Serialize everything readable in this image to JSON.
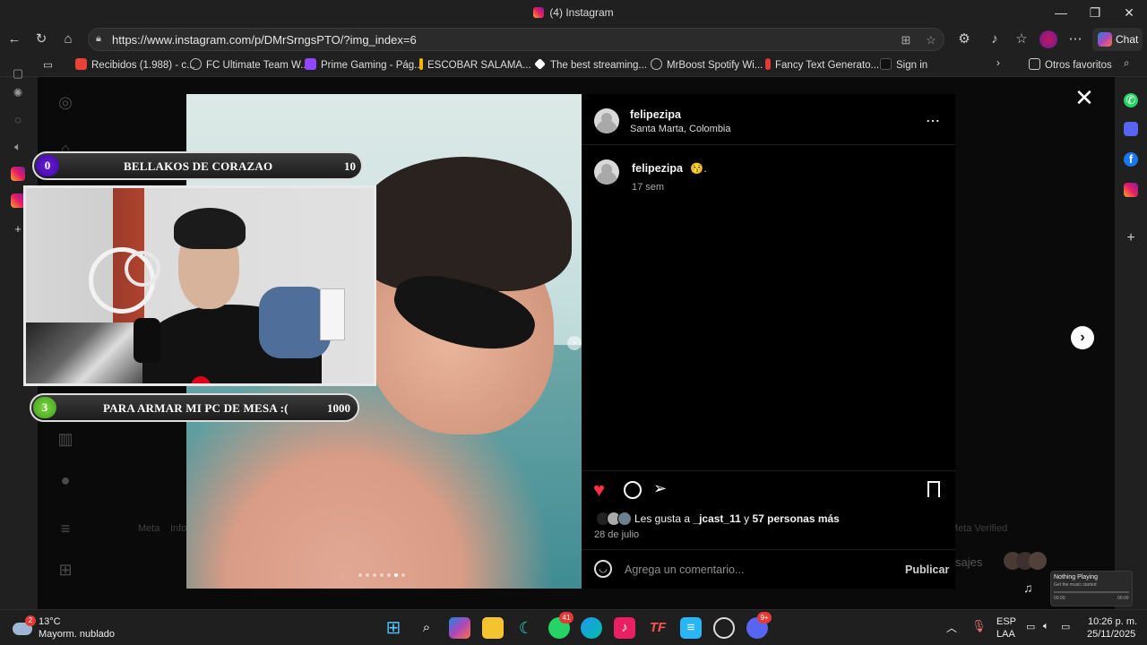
{
  "window": {
    "title": "(4) Instagram",
    "minimize": "—",
    "maximize": "❐",
    "close": "✕"
  },
  "nav": {
    "url": "https://www.instagram.com/p/DMrSrngsPTO/?img_index=6",
    "chat_label": "Chat"
  },
  "bookmarks": [
    {
      "label": "Recibidos (1.988) - c...",
      "color": "#ea4335"
    },
    {
      "label": "FC Ultimate Team W...",
      "color": "#888888"
    },
    {
      "label": "Prime Gaming - Pág...",
      "color": "#9146ff"
    },
    {
      "label": "ESCOBAR SALAMA...",
      "color": "#f4b400"
    },
    {
      "label": "The best streaming...",
      "color": "#ffffff"
    },
    {
      "label": "MrBoost Spotify Wi...",
      "color": "#888888"
    },
    {
      "label": "Fancy Text Generato...",
      "color": "#e53935"
    },
    {
      "label": "Sign in",
      "color": "#111111"
    }
  ],
  "other_favorites": "Otros favoritos",
  "post": {
    "username": "felipezipa",
    "location": "Santa Marta, Colombia",
    "caption_user": "felipezipa",
    "caption_emoji": "😚.",
    "caption_time": "17 sem",
    "likes_text_prefix": "Les gusta a ",
    "likes_user": "_jcast_11",
    "likes_text_mid": " y ",
    "likes_count": "57 personas más",
    "date": "28 de julio",
    "comment_placeholder": "Agrega un comentario...",
    "publish_label": "Publicar",
    "carousel_dots": 7,
    "carousel_active": 6
  },
  "background_page": {
    "footer_meta": "Meta",
    "footer_info": "Info",
    "footer_verified": "Meta Verified",
    "messages_partial": "sajes"
  },
  "overlay": {
    "top_bar": {
      "num": "0",
      "label": "BELLAKOS DE CORAZAO",
      "goal": "10"
    },
    "bottom_bar": {
      "num": "3",
      "label": "PARA ARMAR MI PC DE MESA :(",
      "goal": "1000"
    }
  },
  "music_widget": {
    "title": "Nothing Playing",
    "subtitle": "Get the music started",
    "time_left": "00:00",
    "time_right": "00:00"
  },
  "taskbar": {
    "weather_temp": "13°C",
    "weather_desc": "Mayorm. nublado",
    "weather_badge": "2",
    "whatsapp_badge": "41",
    "discord_badge": "9+",
    "lang_top": "ESP",
    "lang_bottom": "LAA",
    "time": "10:26 p. m.",
    "date": "25/11/2025"
  }
}
